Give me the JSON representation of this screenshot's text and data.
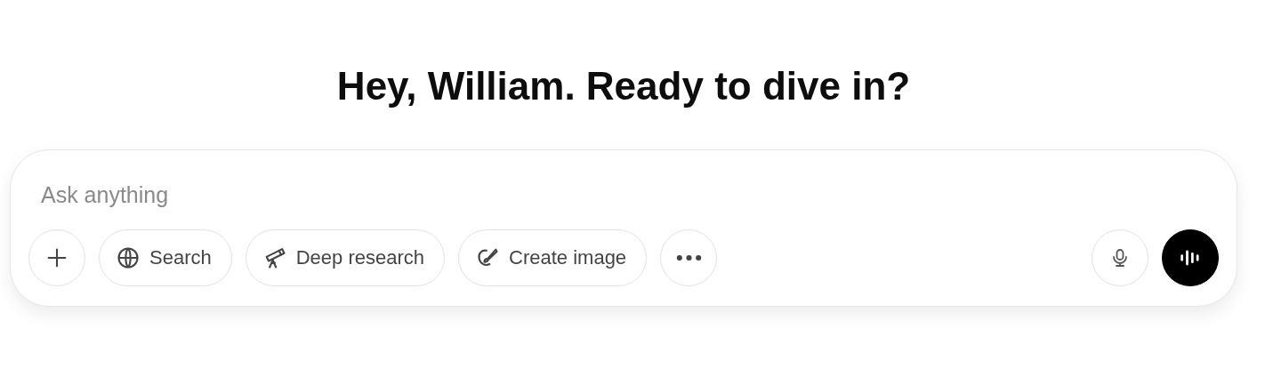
{
  "greeting": "Hey, William. Ready to dive in?",
  "composer": {
    "placeholder": "Ask anything",
    "tools": [
      {
        "kind": "add"
      },
      {
        "kind": "globe",
        "label": "Search"
      },
      {
        "kind": "telescope",
        "label": "Deep research"
      },
      {
        "kind": "brush",
        "label": "Create image"
      },
      {
        "kind": "more"
      }
    ],
    "actions": [
      {
        "kind": "mic"
      },
      {
        "kind": "voice"
      }
    ]
  }
}
